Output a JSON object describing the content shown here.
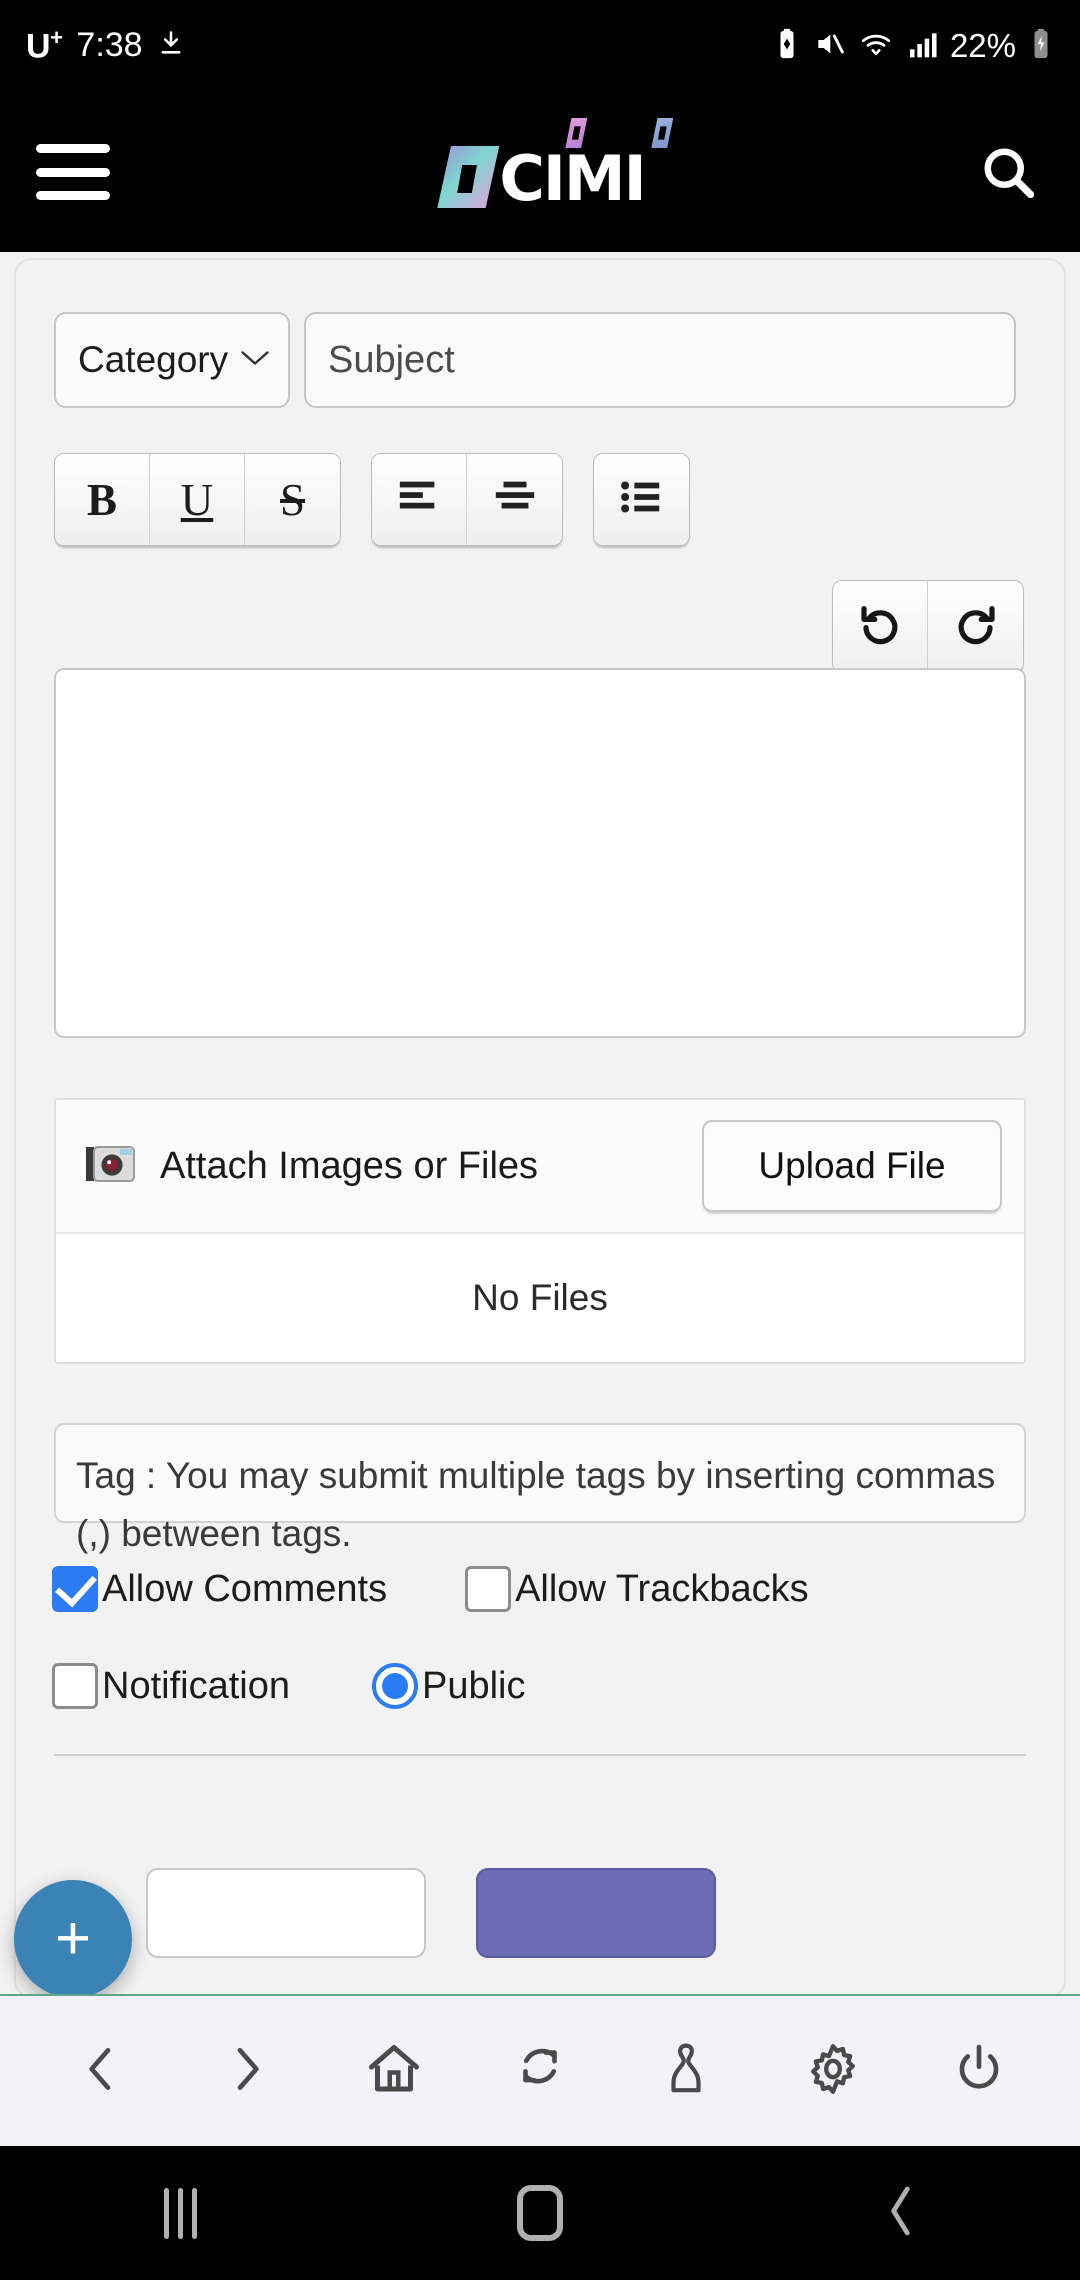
{
  "statusbar": {
    "carrier": "U",
    "carrier_sup": "+",
    "time": "7:38",
    "battery_percent": "22%",
    "icons": [
      "download-icon",
      "battery-saver-icon",
      "mute-icon",
      "wifi-icon",
      "signal-icon",
      "charging-battery-icon"
    ]
  },
  "appbar": {
    "menu_icon": "hamburger-menu-icon",
    "logo_text": "CIMI",
    "logo_letters": [
      "C",
      "I",
      "M",
      "I"
    ],
    "search_icon": "search-icon"
  },
  "form": {
    "category": {
      "label": "Category",
      "chevron": "chevron-down-icon"
    },
    "subject": {
      "placeholder": "Subject",
      "value": ""
    },
    "toolbar": {
      "groups": [
        [
          {
            "name": "bold-button",
            "glyph": "B"
          },
          {
            "name": "underline-button",
            "glyph": "U"
          },
          {
            "name": "strikethrough-button",
            "glyph": "S"
          }
        ],
        [
          {
            "name": "align-left-button",
            "glyph": "align-left-icon"
          },
          {
            "name": "align-center-button",
            "glyph": "align-center-icon"
          }
        ],
        [
          {
            "name": "bullet-list-button",
            "glyph": "bullet-list-icon"
          }
        ]
      ],
      "history": [
        {
          "name": "undo-button",
          "glyph": "undo-icon"
        },
        {
          "name": "redo-button",
          "glyph": "redo-icon"
        }
      ]
    },
    "editor_body": {
      "value": ""
    },
    "attach": {
      "icon": "camera-icon",
      "label": "Attach Images or Files",
      "upload_label": "Upload File",
      "empty_text": "No Files"
    },
    "tag": {
      "placeholder": "Tag : You may submit multiple tags by inserting commas (,) between tags."
    },
    "options": [
      {
        "name": "allow-comments",
        "label": "Allow Comments",
        "type": "checkbox",
        "checked": true
      },
      {
        "name": "allow-trackbacks",
        "label": "Allow Trackbacks",
        "type": "checkbox",
        "checked": false
      },
      {
        "name": "notification",
        "label": "Notification",
        "type": "checkbox",
        "checked": false
      },
      {
        "name": "public",
        "label": "Public",
        "type": "radio",
        "checked": true
      }
    ],
    "footer_buttons": [
      {
        "name": "secondary-button",
        "label": ""
      },
      {
        "name": "primary-button",
        "label": ""
      }
    ]
  },
  "fab": {
    "label": "+",
    "color": "#3b82b5"
  },
  "browserbar": {
    "items": [
      {
        "name": "browser-back-button",
        "icon": "chevron-left-icon"
      },
      {
        "name": "browser-forward-button",
        "icon": "chevron-right-icon"
      },
      {
        "name": "browser-home-button",
        "icon": "home-icon"
      },
      {
        "name": "browser-refresh-button",
        "icon": "refresh-icon"
      },
      {
        "name": "browser-account-button",
        "icon": "person-icon"
      },
      {
        "name": "browser-settings-button",
        "icon": "gear-icon"
      },
      {
        "name": "browser-exit-button",
        "icon": "power-icon"
      }
    ]
  },
  "navbar": {
    "items": [
      {
        "name": "android-recents-button",
        "icon": "recents-icon"
      },
      {
        "name": "android-home-button",
        "icon": "home-circle-icon"
      },
      {
        "name": "android-back-button",
        "icon": "chevron-left-icon"
      }
    ]
  },
  "colors": {
    "accent_blue": "#2b7bf3",
    "fab_blue": "#3b82b5",
    "primary_purple": "#6b6cb4",
    "page_bg": "#f2f2f2",
    "browserbar_bg": "#f3f2f7",
    "browserbar_border": "#5fa887"
  }
}
